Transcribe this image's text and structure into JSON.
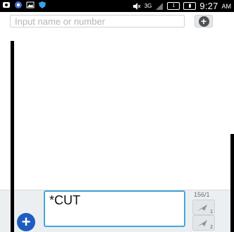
{
  "status_bar": {
    "left_icons": [
      "notification-icon",
      "chat-bubble-icon",
      "image-icon",
      "shield-icon"
    ],
    "mute_icon": "volume-muted-icon",
    "network": "3G",
    "time": "9:27",
    "ampm": "AM"
  },
  "recipient": {
    "placeholder": "Input name or number",
    "add_icon": "add-contact-icon"
  },
  "compose": {
    "message_text": "*CUT",
    "char_counter": "156/1",
    "attach_icon": "add-attachment-icon",
    "send_icon": "send-icon",
    "colors": {
      "input_border": "#48a6d8",
      "attach_button": "#1e5cc0",
      "compose_background": "#eceff1"
    }
  }
}
